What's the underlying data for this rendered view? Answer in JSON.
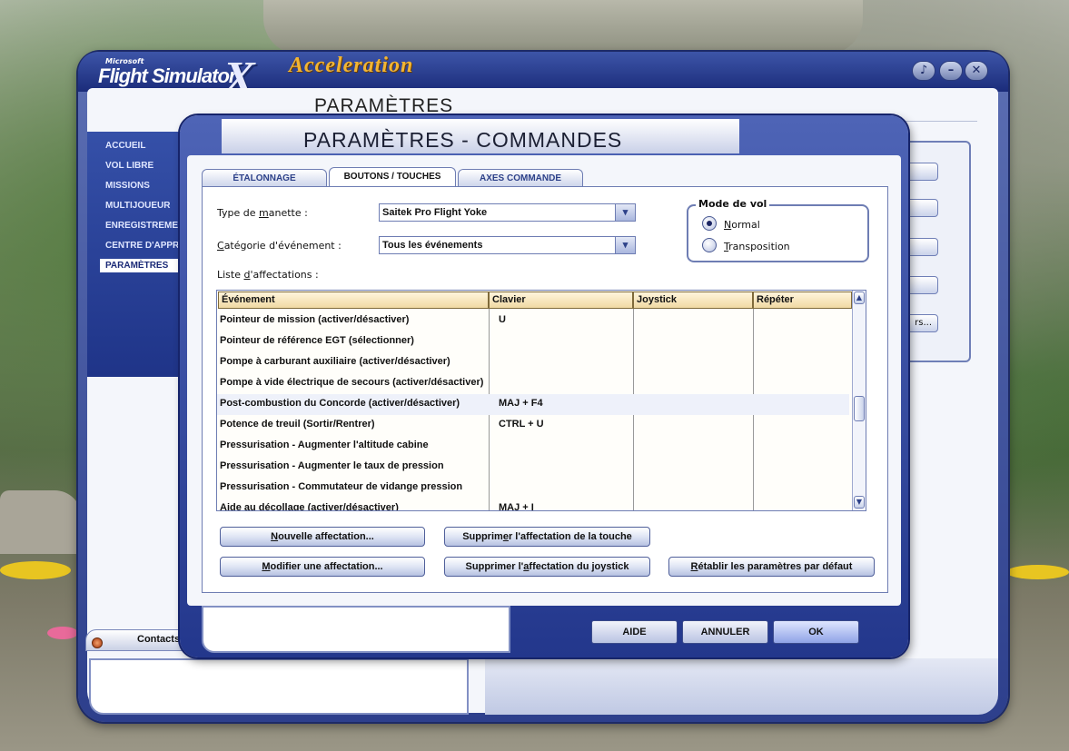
{
  "app": {
    "brand_microsoft": "Microsoft",
    "brand_name": "Flight Simulator",
    "brand_x": "X",
    "brand_edition": "Acceleration",
    "page_title": "PARAMÈTRES",
    "win_sound": "♪",
    "win_min": "–",
    "win_close": "✕"
  },
  "sidebar": {
    "items": [
      {
        "label": "ACCUEIL"
      },
      {
        "label": "VOL LIBRE"
      },
      {
        "label": "MISSIONS"
      },
      {
        "label": "MULTIJOUEUR"
      },
      {
        "label": "ENREGISTREMENT"
      },
      {
        "label": "CENTRE D'APPRENTISSAGE"
      },
      {
        "label": "PARAMÈTRES"
      }
    ]
  },
  "background_panel": {
    "button_text": "rs..."
  },
  "contacts": {
    "label": "Contacts"
  },
  "dialog": {
    "title": "PARAMÈTRES - COMMANDES",
    "tabs": [
      {
        "label": "ÉTALONNAGE"
      },
      {
        "label": "BOUTONS / TOUCHES"
      },
      {
        "label": "AXES COMMANDE"
      }
    ],
    "controller_type": {
      "label_pre": "Type de ",
      "label_u": "m",
      "label_post": "anette :",
      "value": "Saitek Pro Flight Yoke"
    },
    "event_category": {
      "label_pre": "",
      "label_u": "C",
      "label_post": "atégorie d'événement :",
      "value": "Tous les événements"
    },
    "assignments_label": {
      "pre": "Liste ",
      "u": "d",
      "post": "'affectations :"
    },
    "flight_mode": {
      "title": "Mode de vol",
      "normal_u": "N",
      "normal_rest": "ormal",
      "transpose_u": "T",
      "transpose_rest": "ransposition"
    },
    "table": {
      "headers": [
        "Événement",
        "Clavier",
        "Joystick",
        "Répéter"
      ],
      "rows": [
        {
          "event": "Pointeur de mission (activer/désactiver)",
          "key": "U"
        },
        {
          "event": "Pointeur de référence EGT (sélectionner)",
          "key": ""
        },
        {
          "event": "Pompe à carburant auxiliaire (activer/désactiver)",
          "key": ""
        },
        {
          "event": "Pompe à vide électrique de secours (activer/désactiver)",
          "key": ""
        },
        {
          "event": "Post-combustion du Concorde (activer/désactiver)",
          "key": "MAJ + F4"
        },
        {
          "event": "Potence de treuil (Sortir/Rentrer)",
          "key": "CTRL + U"
        },
        {
          "event": "Pressurisation - Augmenter l'altitude cabine",
          "key": ""
        },
        {
          "event": "Pressurisation - Augmenter le taux de pression",
          "key": ""
        },
        {
          "event": "Pressurisation - Commutateur de vidange pression",
          "key": ""
        },
        {
          "event": "Aide au décollage (activer/désactiver)",
          "key": "MAJ + I"
        }
      ]
    },
    "buttons": {
      "new_u": "N",
      "new_rest": "ouvelle affectation...",
      "modify_u": "M",
      "modify_rest": "odifier une affectation...",
      "remove_key_pre": "Supprim",
      "remove_key_u": "e",
      "remove_key_post": "r l'affectation de la touche",
      "remove_joy_pre": "Supprimer l'",
      "remove_joy_u": "a",
      "remove_joy_post": "ffectation du joystick",
      "reset_u": "R",
      "reset_rest": "établir les paramètres par défaut"
    },
    "footer": {
      "help": "AIDE",
      "cancel": "ANNULER",
      "ok": "OK"
    }
  }
}
